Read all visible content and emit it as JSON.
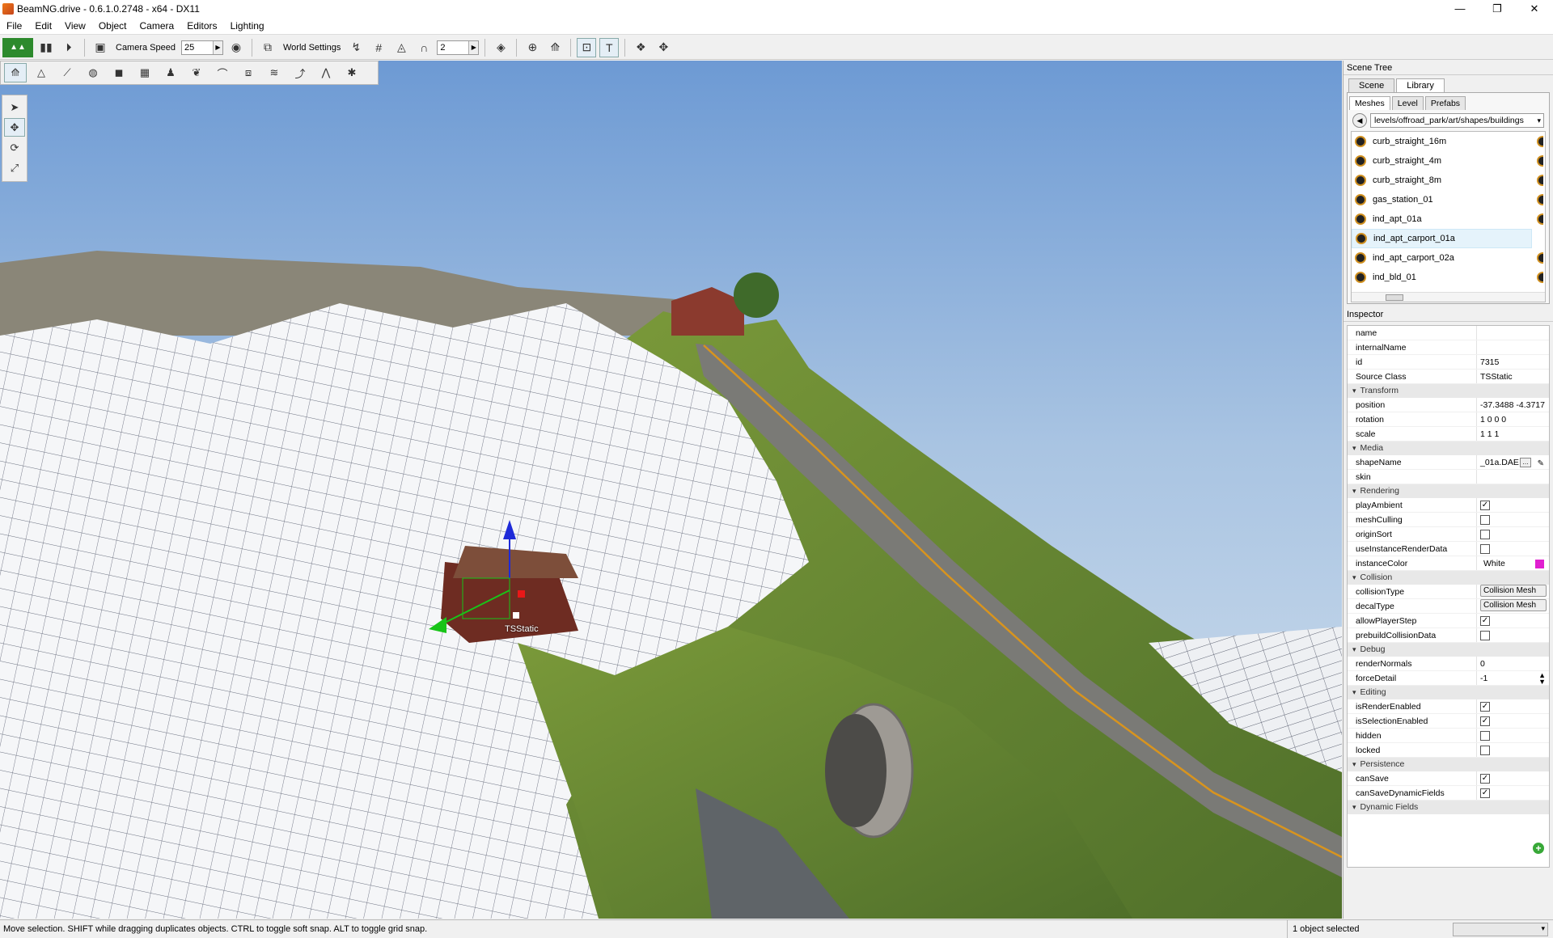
{
  "window": {
    "title": "BeamNG.drive - 0.6.1.0.2748 - x64 - DX11",
    "minimize": "—",
    "restore": "❐",
    "close": "✕"
  },
  "menu": [
    "File",
    "Edit",
    "View",
    "Object",
    "Camera",
    "Editors",
    "Lighting"
  ],
  "toolbar": {
    "camera_speed_label": "Camera Speed",
    "camera_speed_value": "25",
    "world_settings_label": "World Settings",
    "grid_value": "2"
  },
  "icons": {
    "play": "play-icon",
    "camera": "camera-icon",
    "eye": "eye-icon",
    "snap": "magnet-icon",
    "select": "arrow-icon",
    "move": "move-icon",
    "rotate": "rotate-icon",
    "scale": "scale-icon"
  },
  "viewport": {
    "selected_object_label": "TSStatic"
  },
  "scene_tree": {
    "title": "Scene Tree",
    "tabs": [
      "Scene",
      "Library"
    ],
    "selected_tab": "Library",
    "subtabs": [
      "Meshes",
      "Level",
      "Prefabs"
    ],
    "selected_subtab": "Meshes",
    "path": "levels/offroad_park/art/shapes/buildings",
    "meshes": [
      "curb_straight_16m",
      "curb_straight_4m",
      "curb_straight_8m",
      "gas_station_01",
      "ind_apt_01a",
      "ind_apt_carport_01a",
      "ind_apt_carport_02a",
      "ind_bld_01"
    ],
    "selected_mesh": "ind_apt_carport_01a"
  },
  "inspector": {
    "title": "Inspector",
    "top": [
      {
        "k": "name",
        "v": ""
      },
      {
        "k": "internalName",
        "v": ""
      },
      {
        "k": "id",
        "v": "7315"
      },
      {
        "k": "Source Class",
        "v": "TSStatic"
      }
    ],
    "transform_label": "Transform",
    "transform": [
      {
        "k": "position",
        "v": "-37.3488 -4.3717"
      },
      {
        "k": "rotation",
        "v": "1 0 0 0"
      },
      {
        "k": "scale",
        "v": "1 1 1"
      }
    ],
    "media_label": "Media",
    "shape_name_label": "shapeName",
    "shape_name_value": "_01a.DAE",
    "skin_label": "skin",
    "rendering_label": "Rendering",
    "rendering": [
      {
        "k": "playAmbient",
        "checked": true
      },
      {
        "k": "meshCulling",
        "checked": false
      },
      {
        "k": "originSort",
        "checked": false
      },
      {
        "k": "useInstanceRenderData",
        "checked": false
      }
    ],
    "instance_color_label": "instanceColor",
    "instance_color_value": "White",
    "instance_color_hex": "#e01fd0",
    "collision_label": "Collision",
    "collision_type_label": "collisionType",
    "collision_type_value": "Collision Mesh",
    "decal_type_label": "decalType",
    "decal_type_value": "Collision Mesh",
    "collision_checks": [
      {
        "k": "allowPlayerStep",
        "checked": true
      },
      {
        "k": "prebuildCollisionData",
        "checked": false
      }
    ],
    "debug_label": "Debug",
    "render_normals_label": "renderNormals",
    "render_normals_value": "0",
    "force_detail_label": "forceDetail",
    "force_detail_value": "-1",
    "editing_label": "Editing",
    "editing": [
      {
        "k": "isRenderEnabled",
        "checked": true
      },
      {
        "k": "isSelectionEnabled",
        "checked": true
      },
      {
        "k": "hidden",
        "checked": false
      },
      {
        "k": "locked",
        "checked": false
      }
    ],
    "persistence_label": "Persistence",
    "persistence": [
      {
        "k": "canSave",
        "checked": true
      },
      {
        "k": "canSaveDynamicFields",
        "checked": true
      }
    ],
    "dynamic_fields_label": "Dynamic Fields"
  },
  "status": {
    "message": "Move selection.  SHIFT while dragging duplicates objects.  CTRL to toggle soft snap.  ALT to toggle grid snap.",
    "selection_count": "1 object selected"
  }
}
